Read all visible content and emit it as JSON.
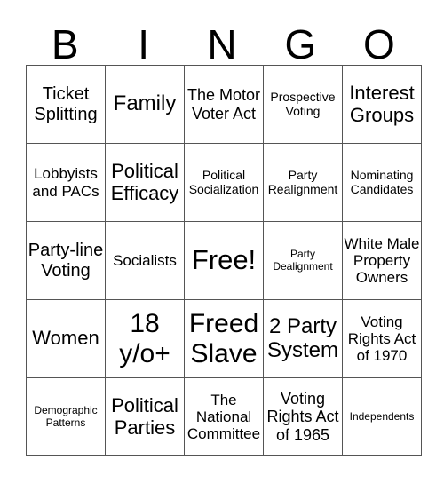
{
  "header": [
    "B",
    "I",
    "N",
    "G",
    "O"
  ],
  "rows": [
    [
      "Ticket Splitting",
      "Family",
      "The Motor Voter Act",
      "Prospective Voting",
      "Interest Groups"
    ],
    [
      "Lobbyists and PACs",
      "Political Efficacy",
      "Political Socialization",
      "Party Realignment",
      "Nominating Candidates"
    ],
    [
      "Party-line Voting",
      "Socialists",
      "Free!",
      "Party Dealignment",
      "White Male Property Owners"
    ],
    [
      "Women",
      "18 y/o+",
      "Freed Slave",
      "2 Party System",
      "Voting Rights Act of 1970"
    ],
    [
      "Demographic Patterns",
      "Political Parties",
      "The National Committee",
      "Voting Rights Act of 1965",
      "Independents"
    ]
  ]
}
